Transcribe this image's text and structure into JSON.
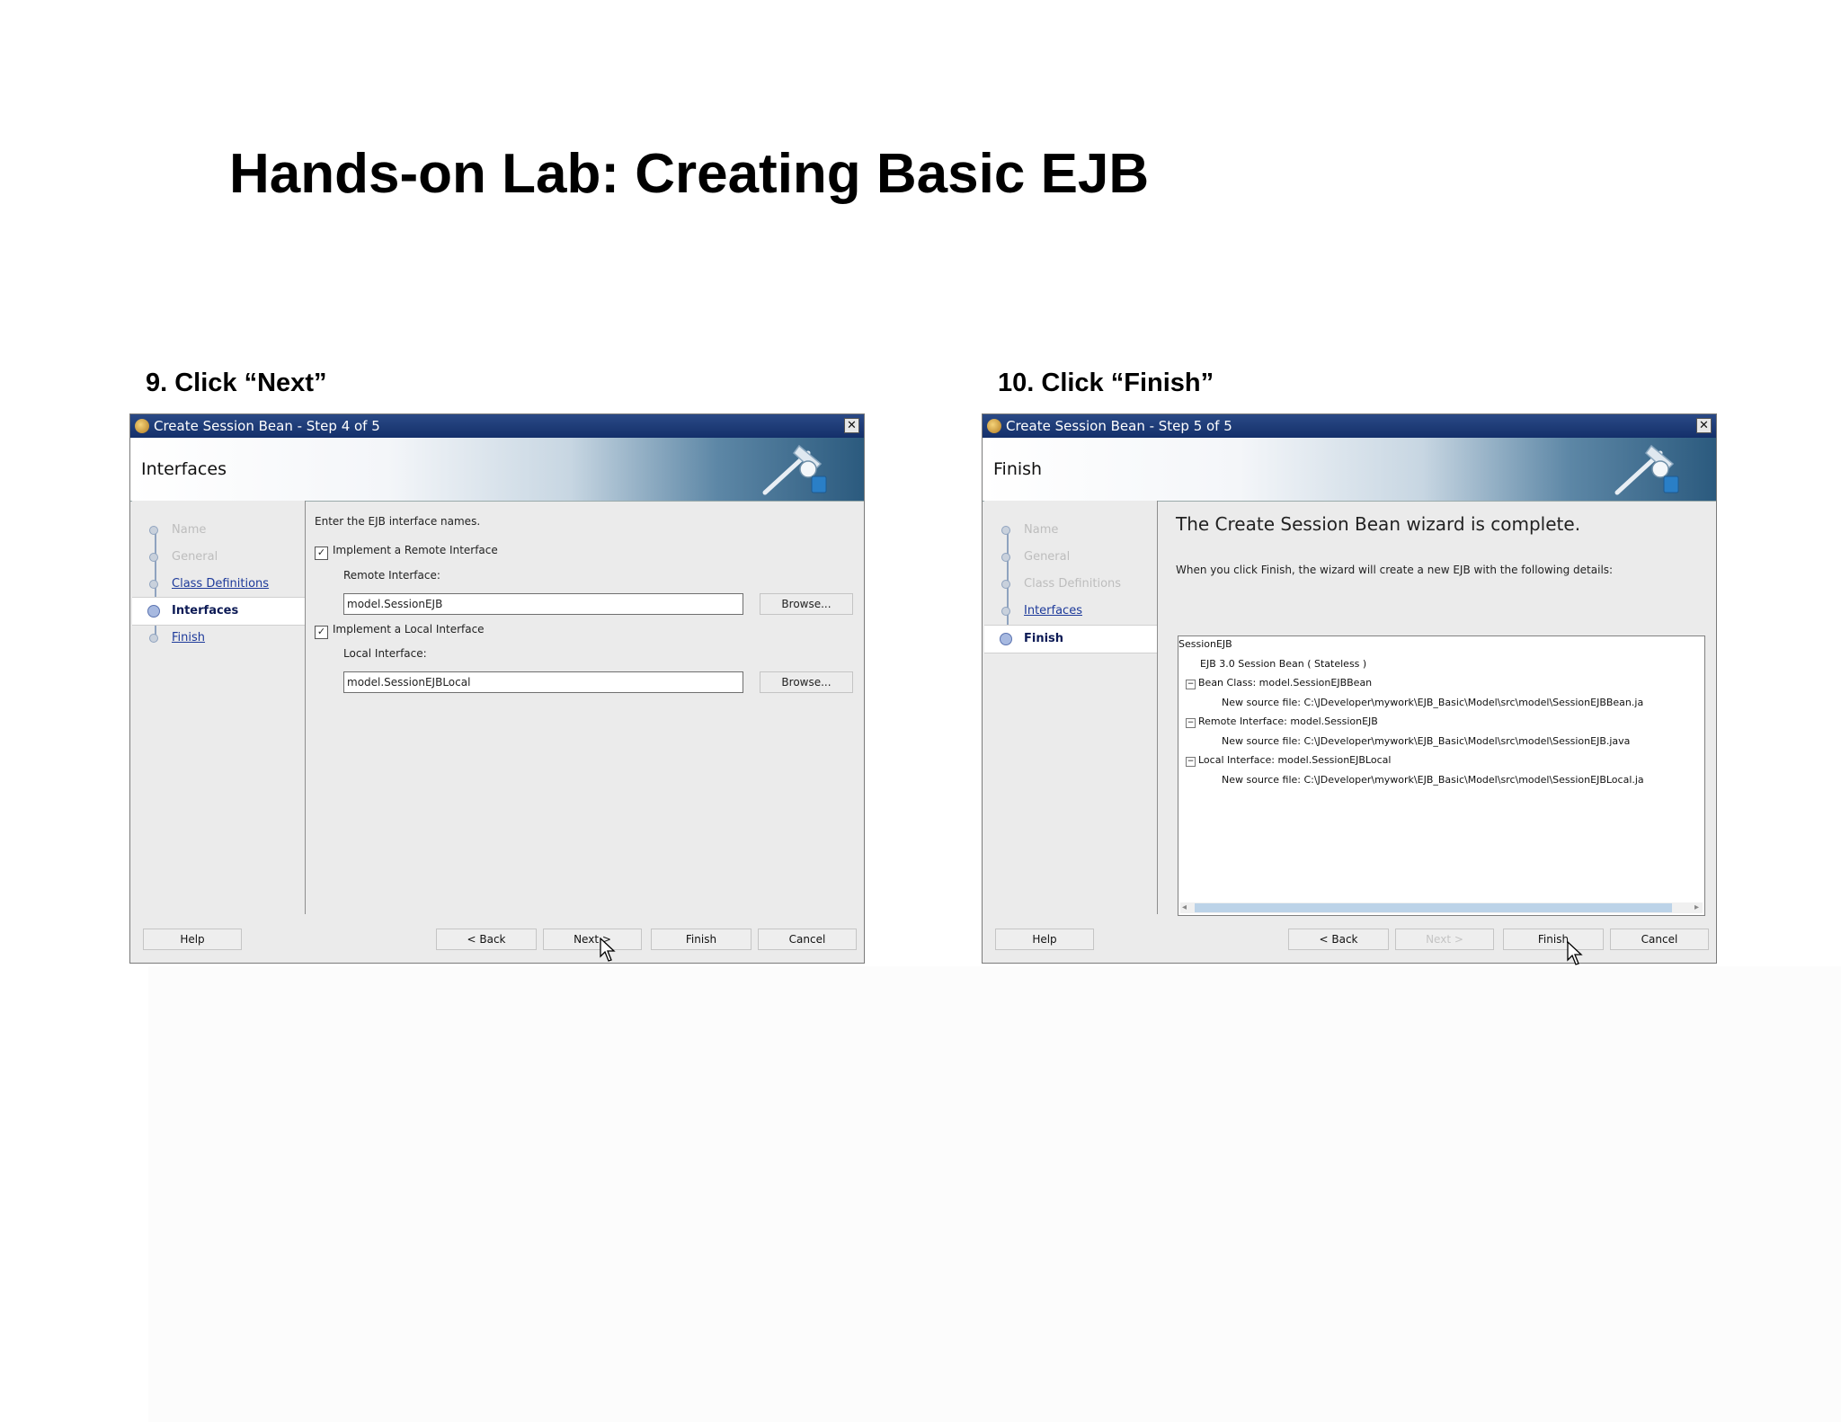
{
  "slide_title": "Hands-on Lab: Creating Basic EJB",
  "left_step": {
    "caption": "9. Click “Next”",
    "dialog": {
      "window_title": "Create Session Bean - Step 4 of 5",
      "close_glyph": "✕",
      "page_heading": "Interfaces",
      "train": [
        {
          "label": "Name",
          "state": "disabled"
        },
        {
          "label": "General",
          "state": "disabled"
        },
        {
          "label": "Class Definitions",
          "state": "link"
        },
        {
          "label": "Interfaces",
          "state": "current"
        },
        {
          "label": "Finish",
          "state": "link"
        }
      ],
      "intro_text": "Enter the EJB interface names.",
      "remote_checkbox_label": "Implement a Remote Interface",
      "remote_checked": "✓",
      "remote_field_label": "Remote Interface:",
      "remote_field_value": "model.SessionEJB",
      "remote_browse": "Browse...",
      "local_checkbox_label": "Implement a Local Interface",
      "local_checked": "✓",
      "local_field_label": "Local Interface:",
      "local_field_value": "model.SessionEJBLocal",
      "local_browse": "Browse...",
      "buttons": {
        "help": "Help",
        "back": "< Back",
        "next": "Next >",
        "finish": "Finish",
        "cancel": "Cancel"
      }
    }
  },
  "right_step": {
    "caption": "10. Click “Finish”",
    "dialog": {
      "window_title": "Create Session Bean - Step 5 of 5",
      "close_glyph": "✕",
      "page_heading": "Finish",
      "train": [
        {
          "label": "Name",
          "state": "disabled"
        },
        {
          "label": "General",
          "state": "disabled"
        },
        {
          "label": "Class Definitions",
          "state": "disabled"
        },
        {
          "label": "Interfaces",
          "state": "link"
        },
        {
          "label": "Finish",
          "state": "current"
        }
      ],
      "complete_heading": "The Create Session Bean wizard is complete.",
      "details_text": "When you click Finish, the wizard will create a new EJB with the following details:",
      "tree": [
        {
          "text": "SessionEJB",
          "indent": 0,
          "expander": ""
        },
        {
          "text": "EJB 3.0 Session Bean ( Stateless )",
          "indent": 1,
          "expander": ""
        },
        {
          "text": "Bean Class:  model.SessionEJBBean",
          "indent": 1,
          "expander": "−"
        },
        {
          "text": "New source file:  C:\\JDeveloper\\mywork\\EJB_Basic\\Model\\src\\model\\SessionEJBBean.ja",
          "indent": 2,
          "expander": ""
        },
        {
          "text": "Remote Interface:  model.SessionEJB",
          "indent": 1,
          "expander": "−"
        },
        {
          "text": "New source file:  C:\\JDeveloper\\mywork\\EJB_Basic\\Model\\src\\model\\SessionEJB.java",
          "indent": 2,
          "expander": ""
        },
        {
          "text": "Local Interface:  model.SessionEJBLocal",
          "indent": 1,
          "expander": "−"
        },
        {
          "text": "New source file:  C:\\JDeveloper\\mywork\\EJB_Basic\\Model\\src\\model\\SessionEJBLocal.ja",
          "indent": 2,
          "expander": ""
        }
      ],
      "scroll_left": "◂",
      "scroll_right": "▸",
      "buttons": {
        "help": "Help",
        "back": "< Back",
        "next": "Next >",
        "finish": "Finish",
        "cancel": "Cancel"
      }
    }
  },
  "colors": {
    "titlebar": "#1f3c78",
    "link": "#1d3a9a",
    "current_step": "#0c1a55"
  },
  "icons": [
    "app-icon",
    "close-icon",
    "wizard-graphic-icon",
    "mouse-cursor-icon"
  ]
}
